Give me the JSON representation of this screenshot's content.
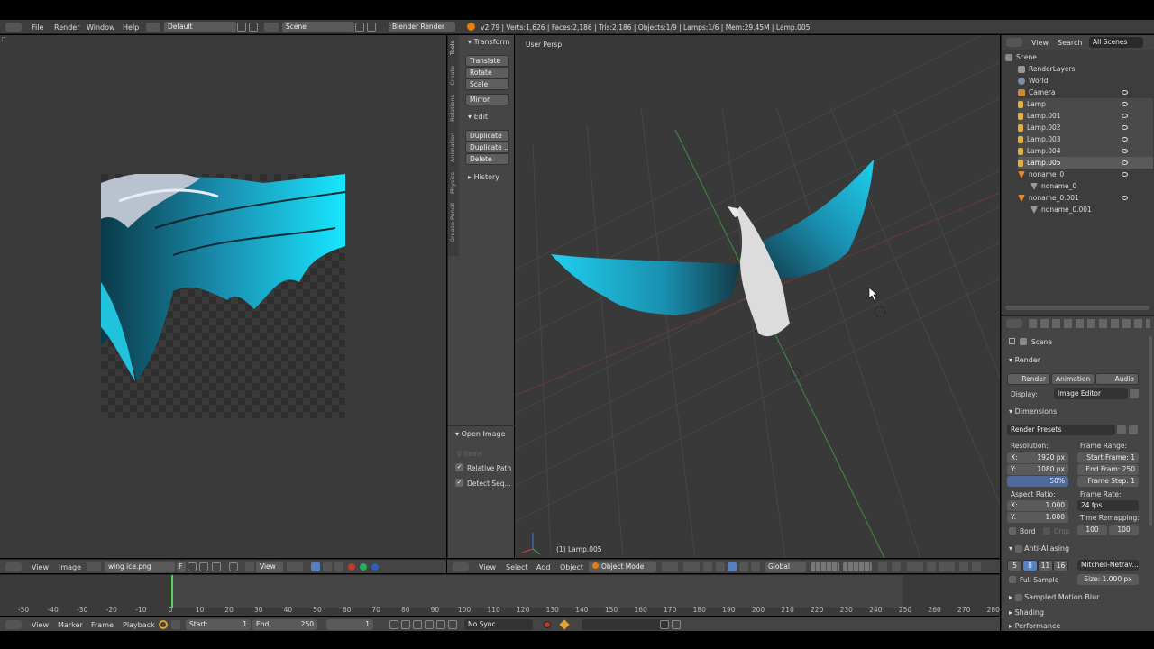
{
  "topbar": {
    "menus": [
      "File",
      "Render",
      "Window",
      "Help"
    ],
    "layout": "Default",
    "scene": "Scene",
    "engine": "Blender Render",
    "stats": "v2.79 | Verts:1,626 | Faces:2,186 | Tris:2,186 | Objects:1/9 | Lamps:1/6 | Mem:29.45M | Lamp.005"
  },
  "image_editor": {
    "header": {
      "view": "View",
      "image": "Image",
      "file": "wing ice.png",
      "f": "F",
      "view2": "View"
    }
  },
  "toolshelf": {
    "tabs": [
      "Tools",
      "Create",
      "Relations",
      "Animation",
      "Physics",
      "Grease Pencil"
    ],
    "transform": {
      "title": "Transform",
      "buttons": [
        "Translate",
        "Rotate",
        "Scale"
      ],
      "mirror": "Mirror"
    },
    "edit": {
      "title": "Edit",
      "buttons": [
        "Duplicate",
        "Duplicate ...",
        "Delete"
      ]
    },
    "history": "History",
    "open_image": {
      "title": "Open Image",
      "items": "0 Items",
      "relative": "Relative Path",
      "detect": "Detect Seq..."
    }
  },
  "viewport": {
    "label": "User Persp",
    "object_label": "(1) Lamp.005",
    "header": {
      "view": "View",
      "select": "Select",
      "add": "Add",
      "object": "Object",
      "mode": "Object Mode",
      "orientation": "Global"
    }
  },
  "outliner": {
    "header": {
      "view": "View",
      "search": "Search",
      "filter": "All Scenes"
    },
    "rows": [
      "Scene",
      "RenderLayers",
      "World",
      "Camera",
      "Lamp",
      "Lamp.001",
      "Lamp.002",
      "Lamp.003",
      "Lamp.004",
      "Lamp.005",
      "noname_0",
      "noname_0",
      "noname_0.001",
      "noname_0.001"
    ]
  },
  "properties": {
    "scene": "Scene",
    "render_title": "Render",
    "render_buttons": [
      "Render",
      "Animation",
      "Audio"
    ],
    "display_label": "Display:",
    "display_value": "Image Editor",
    "dimensions": "Dimensions",
    "presets": "Render Presets",
    "resolution_label": "Resolution:",
    "res_x": "X:",
    "res_x_val": "1920 px",
    "res_y": "Y:",
    "res_y_val": "1080 px",
    "res_pct": "50%",
    "frame_range_label": "Frame Range:",
    "start_frame": "Start Frame: 1",
    "end_frame": "End Fram: 250",
    "frame_step": "Frame Step: 1",
    "aspect_label": "Aspect Ratio:",
    "asp_x": "X:",
    "asp_x_val": "1.000",
    "asp_y": "Y:",
    "asp_y_val": "1.000",
    "frame_rate_label": "Frame Rate:",
    "fps": "24 fps",
    "time_remap": "Time Remapping:",
    "remap_a": "100",
    "remap_b": "100",
    "bord": "Bord",
    "crop": "Crop",
    "anti_aliasing": "Anti-Aliasing",
    "aa_samples": [
      "5",
      "8",
      "11",
      "16"
    ],
    "aa_filter": "Mitchell-Netrav...",
    "full_sample": "Full Sample",
    "size": "Size: 1.000 px",
    "motion_blur": "Sampled Motion Blur",
    "shading": "Shading",
    "performance": "Performance"
  },
  "timeline": {
    "ticks": [
      "-50",
      "-40",
      "-30",
      "-20",
      "-10",
      "0",
      "10",
      "20",
      "30",
      "40",
      "50",
      "60",
      "70",
      "80",
      "90",
      "100",
      "110",
      "120",
      "130",
      "140",
      "150",
      "160",
      "170",
      "180",
      "190",
      "200",
      "210",
      "220",
      "230",
      "240",
      "250",
      "260",
      "270",
      "280"
    ],
    "menus": [
      "View",
      "Marker",
      "Frame",
      "Playback"
    ],
    "start": "Start:",
    "start_val": "1",
    "end": "End:",
    "end_val": "250",
    "current": "1",
    "sync": "No Sync"
  },
  "colors": {
    "accent_blue": "#5680c2",
    "wing_cyan": "#14d4f0",
    "bg_view": "#393939"
  }
}
